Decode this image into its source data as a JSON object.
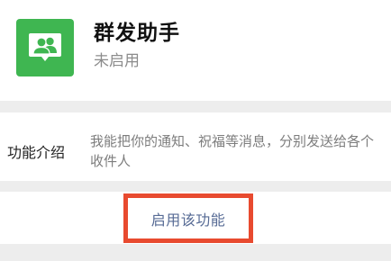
{
  "app": {
    "name": "群发助手",
    "status": "未启用",
    "icon": "group-message-icon",
    "icon_color": "#3fb651"
  },
  "intro": {
    "label": "功能介绍",
    "text": "我能把你的通知、祝福等消息，分别发送给各个收件人"
  },
  "action": {
    "enable_label": "启用该功能",
    "link_color": "#576b95",
    "highlight_color": "#e84a2f"
  }
}
